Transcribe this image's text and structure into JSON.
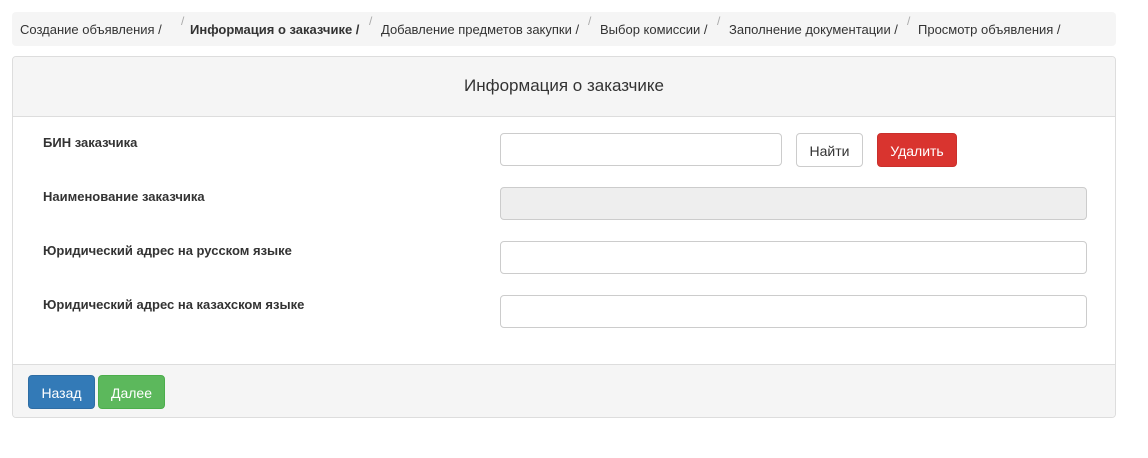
{
  "breadcrumb": {
    "items": [
      {
        "label": "Создание объявления /"
      },
      {
        "label": "Информация о заказчике /"
      },
      {
        "label": "Добавление предметов закупки /"
      },
      {
        "label": "Выбор комиссии /"
      },
      {
        "label": "Заполнение документации /"
      },
      {
        "label": "Просмотр объявления /"
      }
    ],
    "separator": "/"
  },
  "panel": {
    "title": "Информация о заказчике"
  },
  "form": {
    "bin_label": "БИН заказчика",
    "bin_value": "",
    "find_button": "Найти",
    "delete_button": "Удалить",
    "name_label": "Наименование заказчика",
    "name_value": "",
    "address_ru_label": "Юридический адрес на русском языке",
    "address_ru_value": "",
    "address_kz_label": "Юридический адрес на казахском языке",
    "address_kz_value": ""
  },
  "footer": {
    "back_button": "Назад",
    "next_button": "Далее"
  },
  "colors": {
    "primary": "#337ab7",
    "success": "#5cb85c",
    "danger": "#d9342f"
  }
}
